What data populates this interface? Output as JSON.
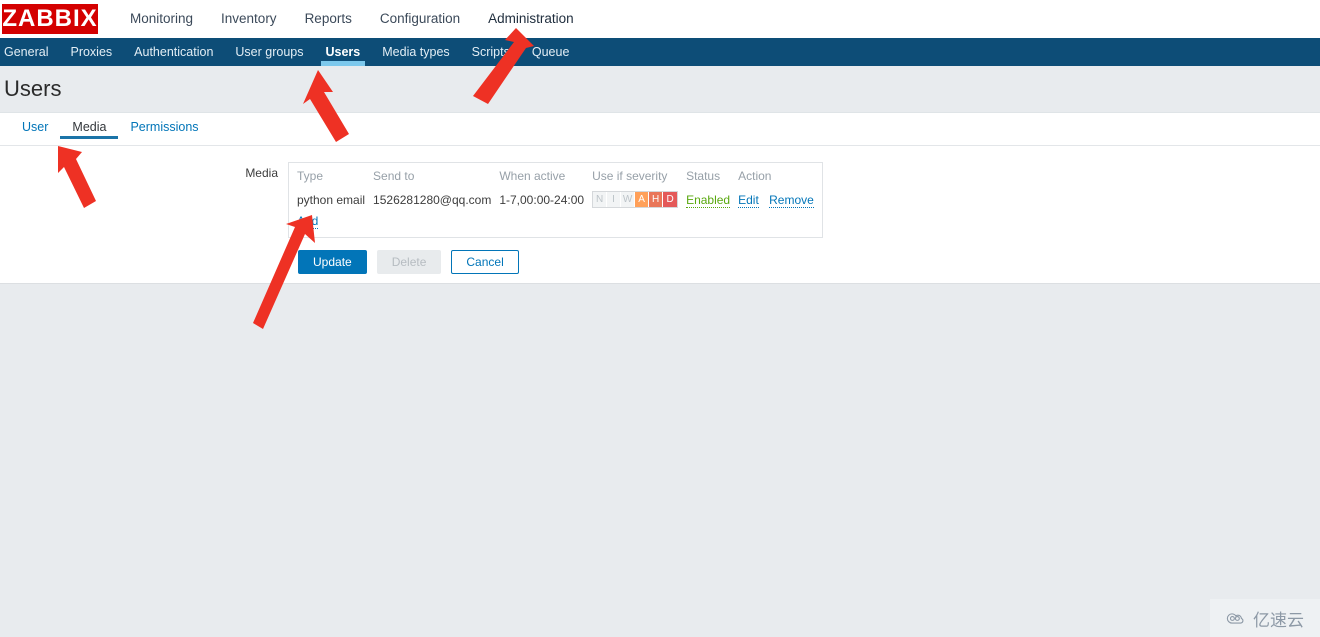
{
  "header": {
    "logo_text": "ZABBIX",
    "nav": [
      {
        "label": "Monitoring",
        "active": false
      },
      {
        "label": "Inventory",
        "active": false
      },
      {
        "label": "Reports",
        "active": false
      },
      {
        "label": "Configuration",
        "active": false
      },
      {
        "label": "Administration",
        "active": true
      }
    ]
  },
  "subnav": [
    {
      "label": "General",
      "active": false
    },
    {
      "label": "Proxies",
      "active": false
    },
    {
      "label": "Authentication",
      "active": false
    },
    {
      "label": "User groups",
      "active": false
    },
    {
      "label": "Users",
      "active": true
    },
    {
      "label": "Media types",
      "active": false
    },
    {
      "label": "Scripts",
      "active": false
    },
    {
      "label": "Queue",
      "active": false
    }
  ],
  "page": {
    "title": "Users"
  },
  "tabs": [
    {
      "label": "User",
      "active": false
    },
    {
      "label": "Media",
      "active": true
    },
    {
      "label": "Permissions",
      "active": false
    }
  ],
  "form": {
    "media_label": "Media",
    "table": {
      "headers": [
        "Type",
        "Send to",
        "When active",
        "Use if severity",
        "Status",
        "Action"
      ],
      "rows": [
        {
          "type": "python email",
          "send_to": "1526281280@qq.com",
          "when_active": "1-7,00:00-24:00",
          "severity": [
            {
              "letter": "N",
              "enabled": false,
              "color": "#f2f4f5"
            },
            {
              "letter": "I",
              "enabled": false,
              "color": "#f2f4f5"
            },
            {
              "letter": "W",
              "enabled": false,
              "color": "#f2f4f5"
            },
            {
              "letter": "A",
              "enabled": true,
              "color": "#ffa059"
            },
            {
              "letter": "H",
              "enabled": true,
              "color": "#e97659"
            },
            {
              "letter": "D",
              "enabled": true,
              "color": "#e45959"
            }
          ],
          "status": "Enabled",
          "actions": [
            "Edit",
            "Remove"
          ]
        }
      ],
      "add_link": "Add"
    }
  },
  "buttons": {
    "update": "Update",
    "delete": "Delete",
    "cancel": "Cancel"
  },
  "watermark": {
    "text": "亿速云",
    "icon": "cloud-icon"
  },
  "colors": {
    "brand_red": "#d40000",
    "subnav_blue": "#0d4d77",
    "link_blue": "#0275b8",
    "accent_underline": "#7cc8ec",
    "status_green": "#59a80f",
    "arrow_red": "#ee3124",
    "page_bg": "#e8ebee"
  }
}
